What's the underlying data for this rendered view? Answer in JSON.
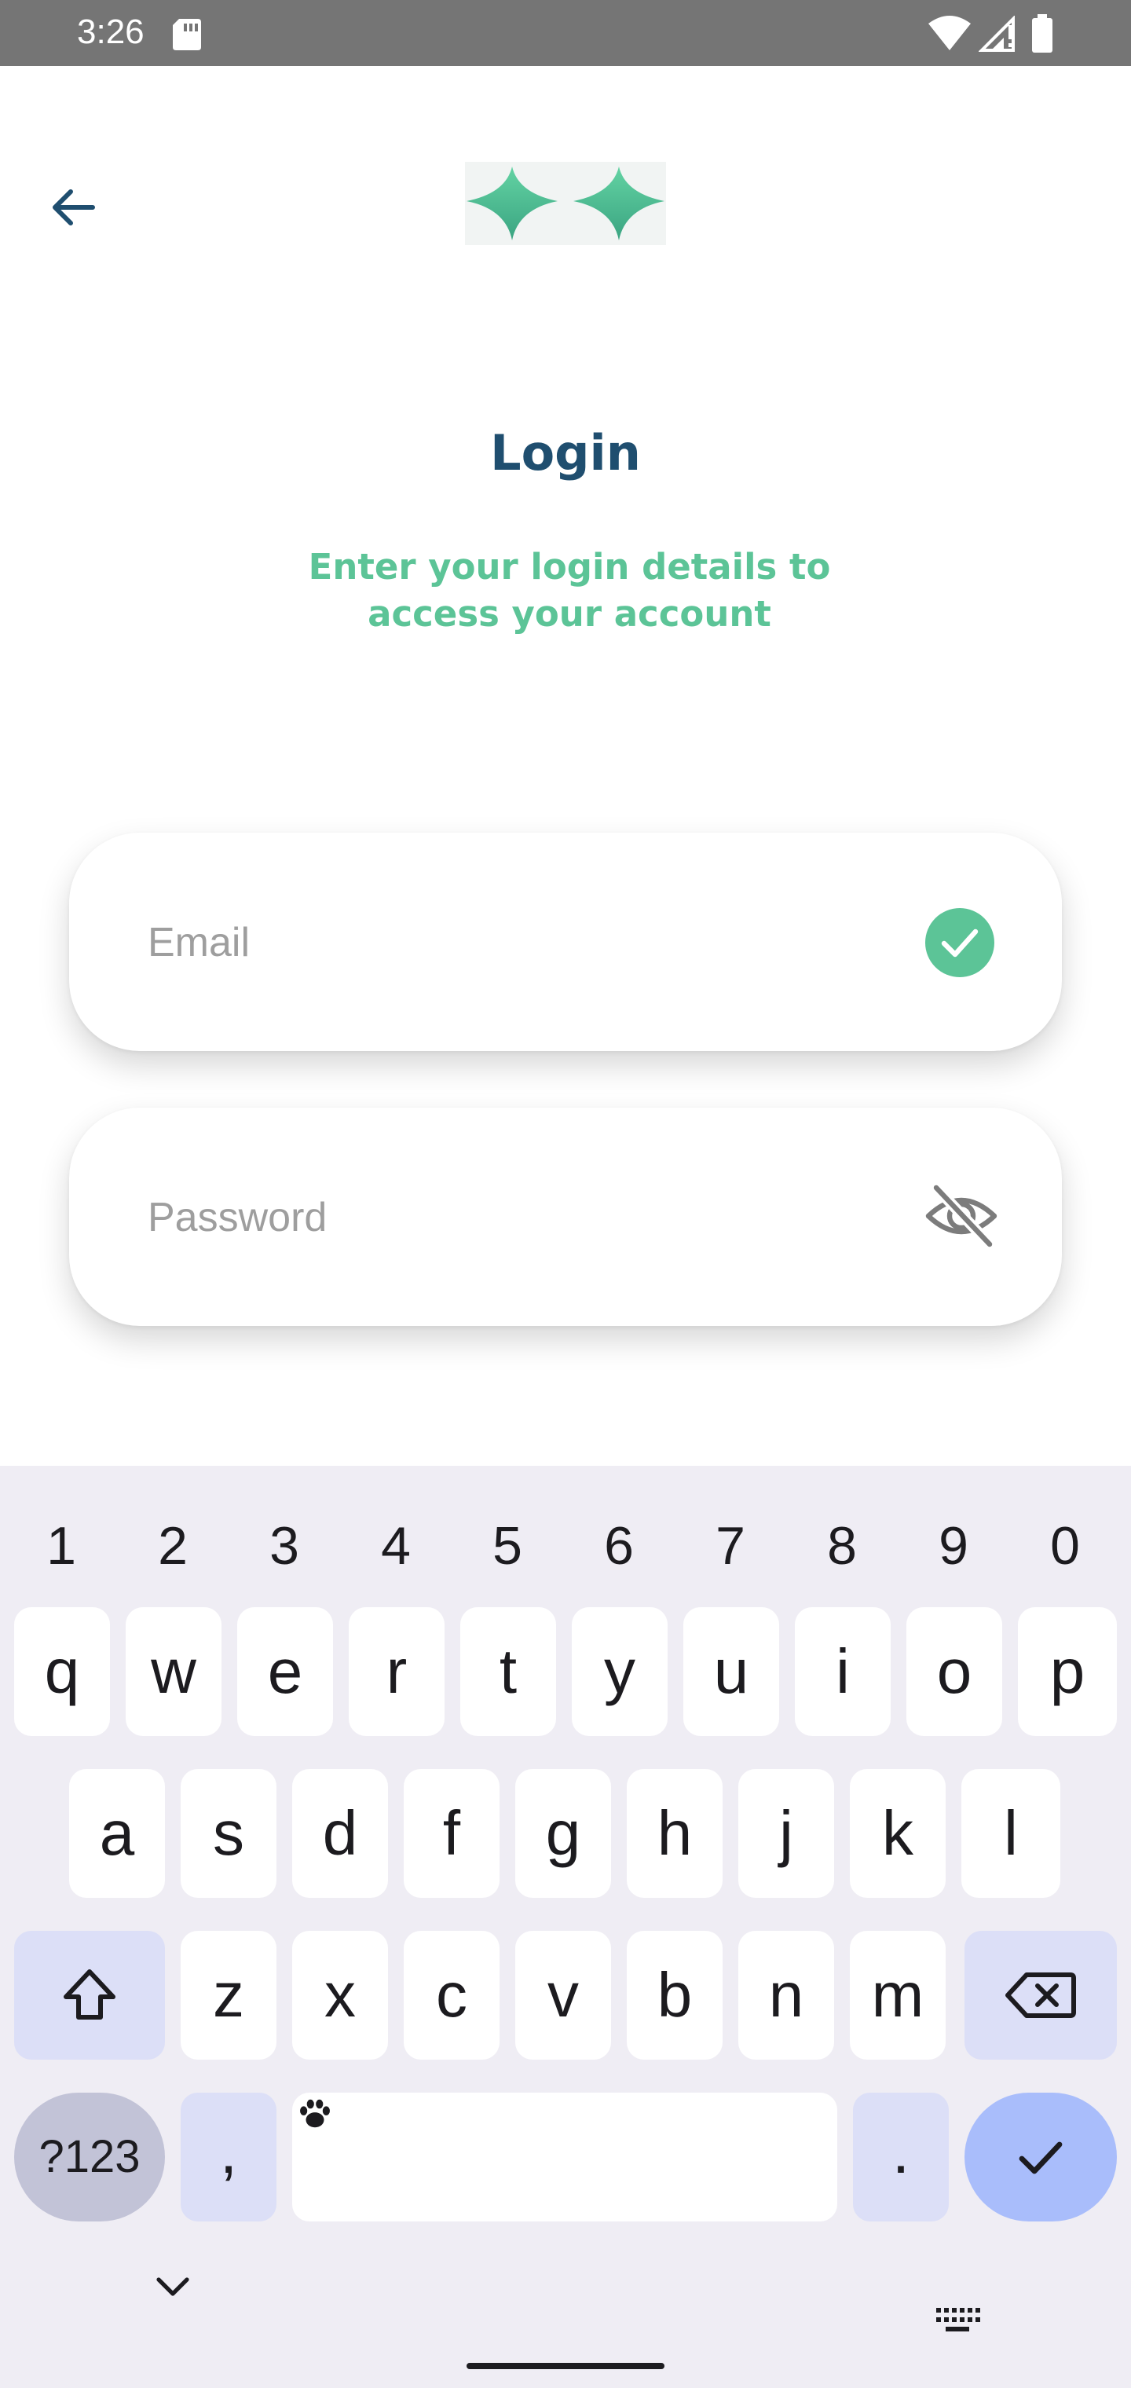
{
  "status_bar": {
    "time": "3:26",
    "icons": [
      "sd-card-icon",
      "wifi-icon",
      "signal-icon",
      "battery-icon"
    ]
  },
  "header": {
    "back_icon": "arrow-left-icon",
    "logo": "sparkles-logo"
  },
  "login": {
    "title": "Login",
    "subtitle": "Enter your login details to access your account"
  },
  "form": {
    "email": {
      "value": "",
      "placeholder": "Email",
      "status_icon": "check-circle-icon"
    },
    "password": {
      "value": "",
      "placeholder": "Password",
      "toggle_icon": "eye-off-icon"
    }
  },
  "colors": {
    "title": "#1f4e6f",
    "accent_green": "#5cc497",
    "status_bar": "#757575",
    "keyboard_bg": "#efedf4"
  },
  "keyboard": {
    "number_row": [
      "1",
      "2",
      "3",
      "4",
      "5",
      "6",
      "7",
      "8",
      "9",
      "0"
    ],
    "row1": [
      "q",
      "w",
      "e",
      "r",
      "t",
      "y",
      "u",
      "i",
      "o",
      "p"
    ],
    "row2": [
      "a",
      "s",
      "d",
      "f",
      "g",
      "h",
      "j",
      "k",
      "l"
    ],
    "row3": [
      "z",
      "x",
      "c",
      "v",
      "b",
      "n",
      "m"
    ],
    "symbols_label": "?123",
    "comma": ",",
    "period": ".",
    "icons": [
      "shift-icon",
      "backspace-icon",
      "enter-check-icon",
      "emoji-paw-icon",
      "keyboard-hide-icon",
      "keyboard-switch-icon"
    ]
  }
}
